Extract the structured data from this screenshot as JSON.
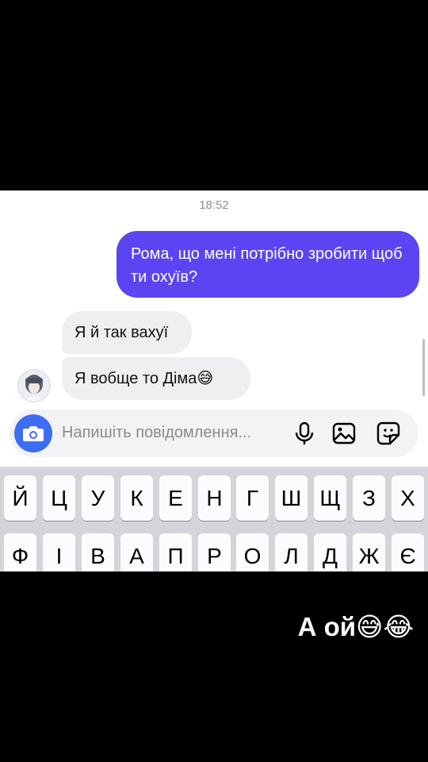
{
  "chat": {
    "timestamp": "18:52",
    "messages": [
      {
        "sender": "me",
        "text": "Рома, що мені потрібно зробити щоб ти охуїв?"
      },
      {
        "sender": "other",
        "text": "Я й так вахуї"
      },
      {
        "sender": "other",
        "text": "Я вобще то Діма😅"
      }
    ]
  },
  "composer": {
    "placeholder": "Напишіть повідомлення...",
    "icons": [
      "camera-icon",
      "microphone-icon",
      "gallery-icon",
      "sticker-icon"
    ],
    "accent_color": "#3d6cf5"
  },
  "keyboard": {
    "row1": [
      "Й",
      "Ц",
      "У",
      "К",
      "Е",
      "Н",
      "Г",
      "Ш",
      "Щ",
      "З",
      "Х"
    ],
    "row2": [
      "Ф",
      "І",
      "В",
      "А",
      "П",
      "Р",
      "О",
      "Л",
      "Д",
      "Ж",
      "Є"
    ]
  },
  "overlay": {
    "caption": "А ой😅😂"
  },
  "colors": {
    "outgoing_bubble": "#5b44f1",
    "incoming_bubble": "#efeff1"
  }
}
